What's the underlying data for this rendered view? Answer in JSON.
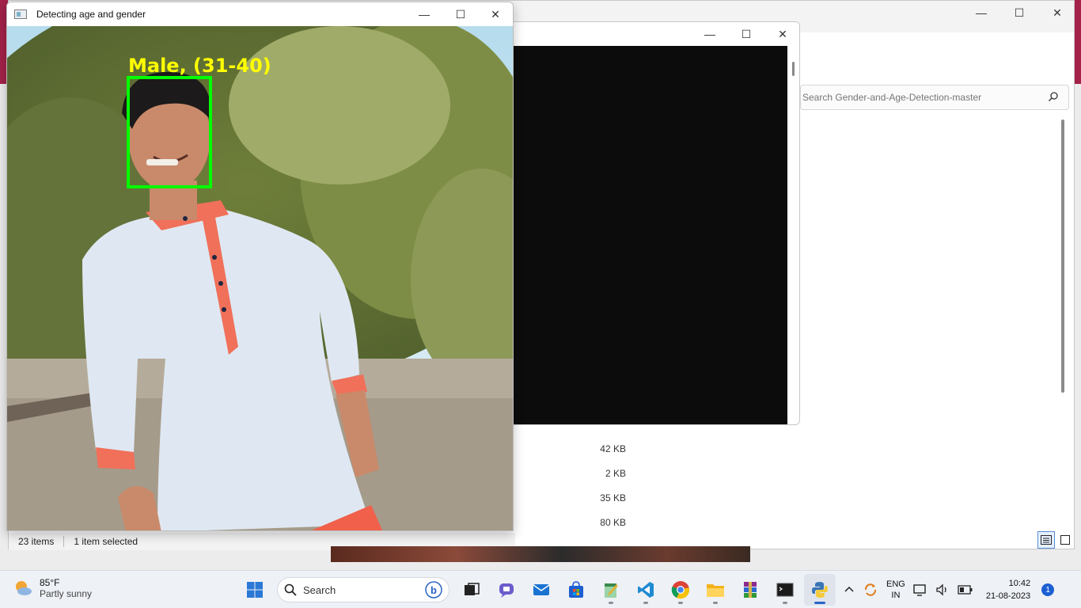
{
  "image_window": {
    "title": "Detecting age and gender",
    "detection_label": "Male, (31-40)",
    "box_color": "#00ff00",
    "label_color": "#ffff00"
  },
  "explorer": {
    "search_placeholder": "Search Gender-and-Age-Detection-master",
    "sizes": [
      "42 KB",
      "2 KB",
      "35 KB",
      "80 KB"
    ],
    "status_items": "23 items",
    "status_selected": "1 item selected"
  },
  "window_controls": {
    "minimize": "—",
    "maximize": "☐",
    "close": "✕"
  },
  "taskbar": {
    "weather_temp": "85°F",
    "weather_condition": "Partly sunny",
    "search_label": "Search",
    "lang_top": "ENG",
    "lang_bottom": "IN",
    "time": "10:42",
    "date": "21-08-2023",
    "notification_count": "1",
    "apps": [
      "start-icon",
      "search",
      "task-view-icon",
      "chat-icon",
      "mail-icon",
      "store-icon",
      "notepad-icon",
      "vscode-icon",
      "chrome-icon",
      "file-explorer-icon",
      "winrar-icon",
      "terminal-icon",
      "python-icon"
    ]
  }
}
